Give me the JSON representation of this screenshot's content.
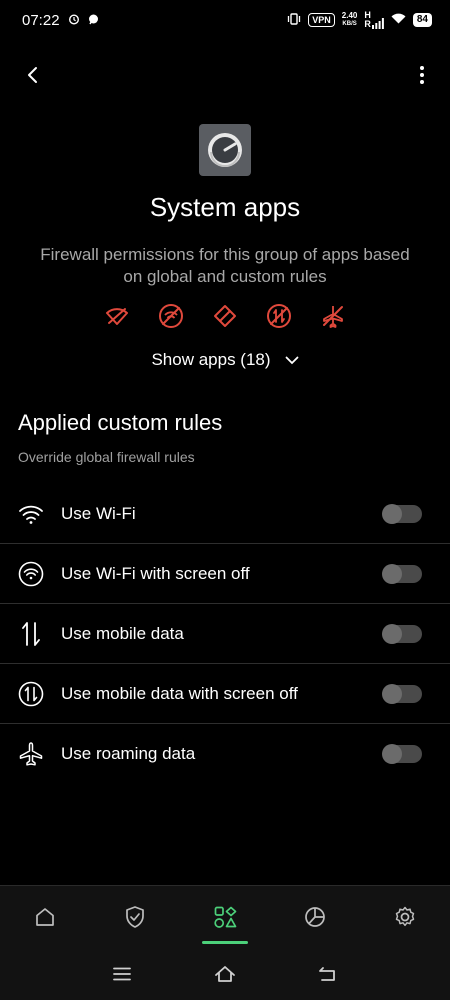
{
  "status_bar": {
    "time": "07:22",
    "vpn": "VPN",
    "speed_value": "2.40",
    "speed_unit": "KB/S",
    "net_h": "H",
    "net_r": "R",
    "battery": "84"
  },
  "header": {
    "title": "System apps",
    "subtitle": "Firewall permissions for this group of apps based on global and custom rules",
    "show_apps_label": "Show apps (18)",
    "blocked_color": "#e0493c"
  },
  "section": {
    "title": "Applied custom rules",
    "subtitle": "Override global firewall rules"
  },
  "rules": [
    {
      "label": "Use Wi-Fi",
      "icon": "wifi-icon",
      "enabled": false
    },
    {
      "label": "Use Wi-Fi with screen off",
      "icon": "wifi-screen-off-icon",
      "enabled": false
    },
    {
      "label": "Use mobile data",
      "icon": "mobile-data-icon",
      "enabled": false
    },
    {
      "label": "Use mobile data with screen off",
      "icon": "mobile-data-screen-off-icon",
      "enabled": false
    },
    {
      "label": "Use roaming data",
      "icon": "airplane-icon",
      "enabled": false
    }
  ],
  "bottom_nav": {
    "items": [
      "home-icon",
      "shield-check-icon",
      "apps-icon",
      "pie-chart-icon",
      "gear-icon"
    ],
    "active_index": 2,
    "accent": "#4cd07a"
  }
}
